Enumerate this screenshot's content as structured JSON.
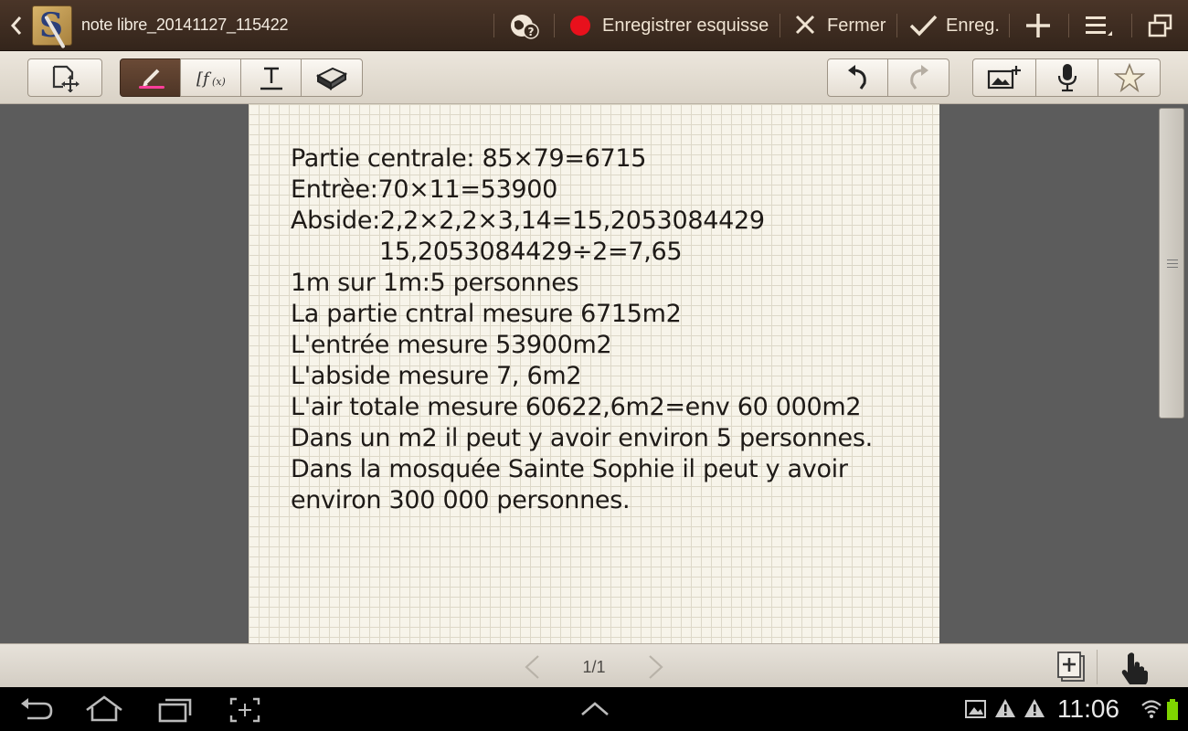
{
  "topbar": {
    "title": "note libre_20141127_115422",
    "app_letter": "S",
    "record_label": "Enregistrer esquisse",
    "close_label": "Fermer",
    "save_label": "Enreg."
  },
  "note": {
    "lines": [
      "Partie centrale: 85×79=6715",
      "Entrèe:70×11=53900",
      "Abside:2,2×2,2×3,14=15,2053084429",
      "15,2053084429÷2=7,65",
      "1m sur 1m:5 personnes",
      "La partie cntral mesure 6715m2",
      "L'entrée mesure 53900m2",
      "L'abside mesure 7, 6m2",
      "L'air totale mesure 60622,6m2=env 60 000m2",
      "Dans un m2 il peut y avoir environ 5 personnes.",
      "Dans la mosquée Sainte Sophie il peut y avoir",
      "environ 300 000 personnes."
    ]
  },
  "pagebar": {
    "page_indicator": "1/1"
  },
  "statusbar": {
    "time": "11:06"
  },
  "colors": {
    "pen_indicator": "#ff3e9a",
    "record_dot": "#e8101c",
    "battery": "#7fd400"
  }
}
